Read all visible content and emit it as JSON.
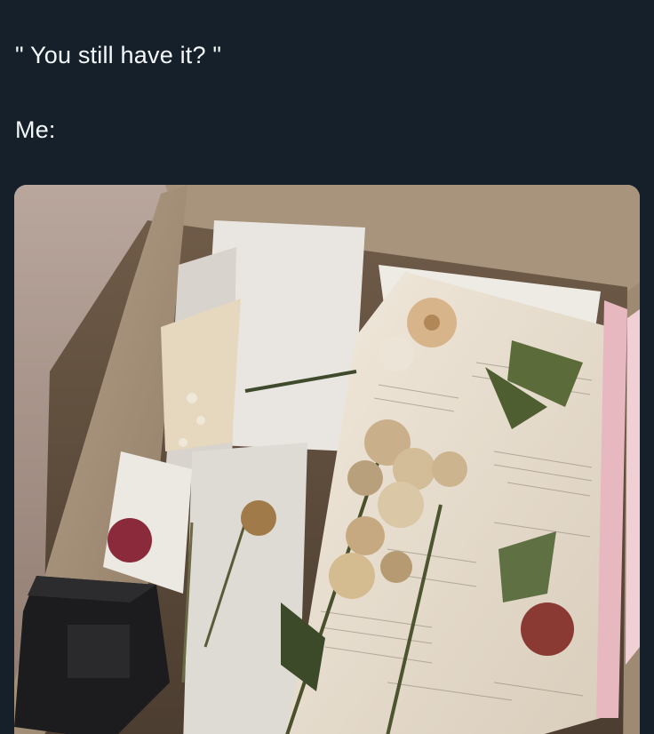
{
  "post": {
    "caption_line_1": "\" You still have it? \"",
    "caption_line_2": "Me:"
  },
  "colors": {
    "background": "#15202b",
    "text": "#f5f8fa"
  },
  "media": {
    "description_icon": "photo-of-box-with-dried-flowers-and-letters"
  }
}
